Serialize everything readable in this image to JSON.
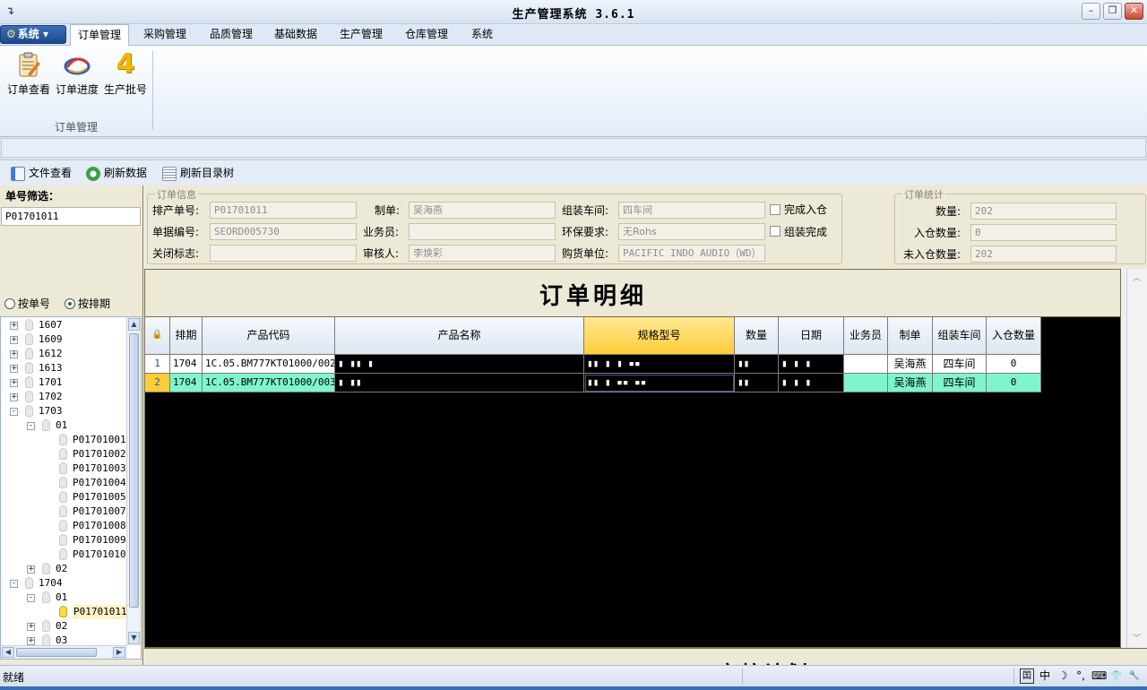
{
  "window": {
    "title": "生产管理系统  3.6.1",
    "controls": {
      "minimize": "–",
      "restore": "❐",
      "close": "✕"
    }
  },
  "ribbon": {
    "system_menu": "系统",
    "tabs": [
      "订单管理",
      "采购管理",
      "品质管理",
      "基础数据",
      "生产管理",
      "仓库管理",
      "系统"
    ],
    "active_tab": "订单管理",
    "buttons": [
      {
        "label": "订单查看",
        "icon": "clipboard-icon"
      },
      {
        "label": "订单进度",
        "icon": "progress-swirl-icon"
      },
      {
        "label": "生产批号",
        "icon": "number-four-icon"
      }
    ],
    "group_label": "订单管理"
  },
  "toolbar": {
    "file_view": "文件查看",
    "refresh_data": "刷新数据",
    "refresh_tree": "刷新目录树"
  },
  "left": {
    "filter_label": "单号筛选：",
    "filter_value": "P01701011",
    "radio_by_order": "按单号",
    "radio_by_schedule": "按排期",
    "radio_selected": "按排期",
    "tree": [
      {
        "label": "1607",
        "level": 0,
        "exp": "+"
      },
      {
        "label": "1609",
        "level": 0,
        "exp": "+"
      },
      {
        "label": "1612",
        "level": 0,
        "exp": "+"
      },
      {
        "label": "1613",
        "level": 0,
        "exp": "+"
      },
      {
        "label": "1701",
        "level": 0,
        "exp": "+"
      },
      {
        "label": "1702",
        "level": 0,
        "exp": "+"
      },
      {
        "label": "1703",
        "level": 0,
        "exp": "-"
      },
      {
        "label": "01",
        "level": 1,
        "exp": "-"
      },
      {
        "label": "P01701001",
        "level": 2,
        "exp": ""
      },
      {
        "label": "P01701002",
        "level": 2,
        "exp": ""
      },
      {
        "label": "P01701003",
        "level": 2,
        "exp": ""
      },
      {
        "label": "P01701004",
        "level": 2,
        "exp": ""
      },
      {
        "label": "P01701005",
        "level": 2,
        "exp": ""
      },
      {
        "label": "P01701007",
        "level": 2,
        "exp": ""
      },
      {
        "label": "P01701008",
        "level": 2,
        "exp": ""
      },
      {
        "label": "P01701009",
        "level": 2,
        "exp": ""
      },
      {
        "label": "P01701010",
        "level": 2,
        "exp": ""
      },
      {
        "label": "02",
        "level": 1,
        "exp": "+"
      },
      {
        "label": "1704",
        "level": 0,
        "exp": "-"
      },
      {
        "label": "01",
        "level": 1,
        "exp": "-"
      },
      {
        "label": "P01701011",
        "level": 2,
        "exp": "",
        "selected": true
      },
      {
        "label": "02",
        "level": 1,
        "exp": "+"
      },
      {
        "label": "03",
        "level": 1,
        "exp": "+"
      }
    ]
  },
  "order_info": {
    "legend": "订单信息",
    "schedule_no_label": "排产单号:",
    "schedule_no": "P01701011",
    "doc_no_label": "单据编号:",
    "doc_no": "SEORD005730",
    "close_flag_label": "关闭标志:",
    "close_flag": "",
    "maker_label": "制单:",
    "maker": "吴海燕",
    "salesman_label": "业务员:",
    "salesman": "",
    "reviewer_label": "审核人:",
    "reviewer": "李焕彩",
    "workshop_label": "组装车间:",
    "workshop": "四车间",
    "env_label": "环保要求:",
    "env": "无Rohs",
    "buyer_label": "购货单位:",
    "buyer": "PACIFIC INDO AUDIO（WD）",
    "check_in_done": "完成入仓",
    "assembly_done": "组装完成"
  },
  "order_stats": {
    "legend": "订单统计",
    "qty_label": "数量:",
    "qty": "202",
    "in_label": "入仓数量:",
    "in_qty": "0",
    "not_in_label": "未入仓数量:",
    "not_in_qty": "202"
  },
  "detail": {
    "title": "订单明细",
    "lock_icon": "lock-icon",
    "columns": [
      "排期",
      "产品代码",
      "产品名称",
      "规格型号",
      "数量",
      "日期",
      "业务员",
      "制单",
      "组装车间",
      "入仓数量"
    ],
    "rows": [
      {
        "no": "1",
        "schedule": "1704",
        "code": "1C.05.BM777KT01000/002",
        "name": "▮  ▮▮ ▮",
        "spec": "▮▮ ▮     ▮   ▪▪",
        "qty": "▮▮",
        "date": "▮  ▮  ▮",
        "salesman": "",
        "maker": "吴海燕",
        "workshop": "四车间",
        "in_qty": "0"
      },
      {
        "no": "2",
        "schedule": "1704",
        "code": "1C.05.BM777KT01000/003",
        "name": "▮   ▮▮",
        "spec": "▮▮ ▮    ▪▪     ▪▪",
        "qty": "▮▮",
        "date": "▮  ▮  ▮",
        "salesman": "",
        "maker": "吴海燕",
        "workshop": "四车间",
        "in_qty": "0"
      }
    ],
    "peek_title": "齐核计划"
  },
  "status": {
    "text": "就绪",
    "ime": [
      "囯",
      "中",
      "☽",
      "°,",
      "⌨",
      "👕",
      "🔧"
    ]
  },
  "colors": {
    "row_highlight": "#7ff5cf",
    "header_highlight": "#ffcd3a",
    "panel_bg": "#ede9d7"
  }
}
